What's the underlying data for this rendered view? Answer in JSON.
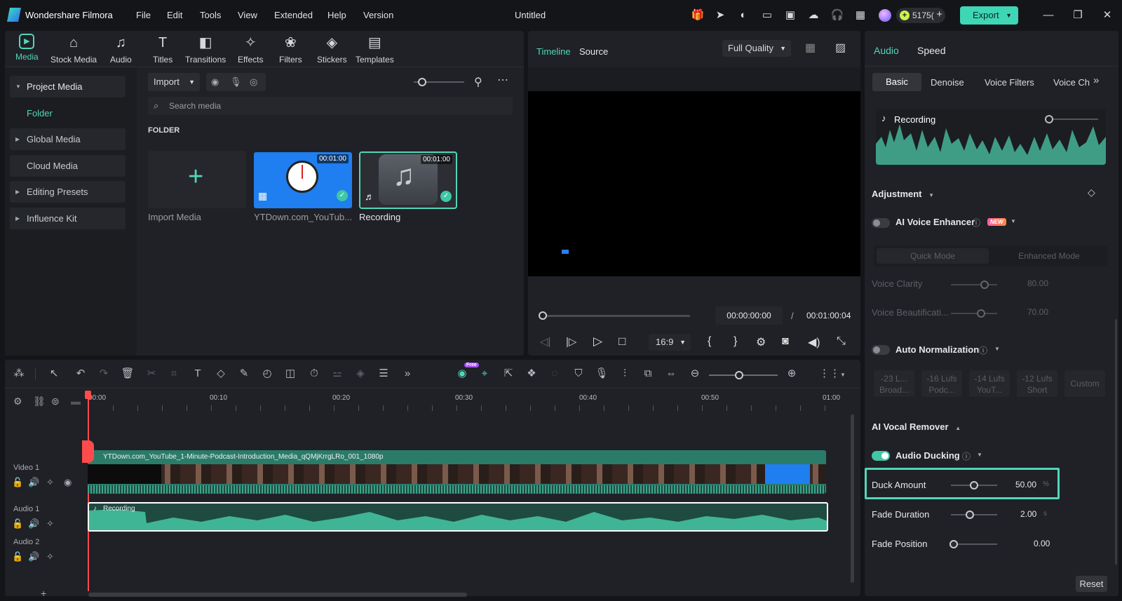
{
  "app": {
    "name": "Wondershare Filmora",
    "doc_title": "Untitled",
    "credits": "5175(",
    "export_label": "Export"
  },
  "menu": [
    "File",
    "Edit",
    "Tools",
    "View",
    "Extended",
    "Help",
    "Version"
  ],
  "media_tabs": [
    "Media",
    "Stock Media",
    "Audio",
    "Titles",
    "Transitions",
    "Effects",
    "Filters",
    "Stickers",
    "Templates"
  ],
  "sidebar": {
    "items": [
      {
        "label": "Project Media",
        "tri": true
      },
      {
        "label": "Folder"
      },
      {
        "label": "Global Media",
        "tri": true
      },
      {
        "label": "Cloud Media"
      },
      {
        "label": "Editing Presets",
        "tri": true
      },
      {
        "label": "Influence Kit",
        "tri": true
      }
    ]
  },
  "media": {
    "import_label": "Import",
    "search_placeholder": "Search media",
    "folder_header": "FOLDER",
    "tiles": [
      {
        "label": "Import Media"
      },
      {
        "label": "YTDown.com_YouTub...",
        "duration": "00:01:00"
      },
      {
        "label": "Recording",
        "duration": "00:01:00"
      }
    ]
  },
  "player": {
    "tabs": [
      "Timeline",
      "Source"
    ],
    "quality": "Full Quality",
    "current_time": "00:00:00:00",
    "separator": "/",
    "total_time": "00:01:00:04",
    "ratio": "16:9"
  },
  "right": {
    "tabs": [
      "Audio",
      "Speed"
    ],
    "subtabs": [
      "Basic",
      "Denoise",
      "Voice Filters",
      "Voice Ch"
    ],
    "clip_name": "Recording",
    "adjustment": "Adjustment",
    "ai_voice_enhancer": "AI Voice Enhancer",
    "new_badge": "NEW",
    "modes": [
      "Quick Mode",
      "Enhanced Mode"
    ],
    "voice_clarity": {
      "label": "Voice Clarity",
      "value": "80.00",
      "level": 0.8
    },
    "voice_beaut": {
      "label": "Voice Beautificati...",
      "value": "70.00",
      "level": 0.7
    },
    "auto_normalization": "Auto Normalization",
    "lufs": [
      [
        "-23 L...",
        "Broad..."
      ],
      [
        "-16 Lufs",
        "Podc..."
      ],
      [
        "-14 Lufs",
        "YouT..."
      ],
      [
        "-12 Lufs",
        "Short"
      ],
      [
        "Custom",
        ""
      ]
    ],
    "ai_vocal_remover": "AI Vocal Remover",
    "audio_ducking": "Audio Ducking",
    "duck_amount": {
      "label": "Duck Amount",
      "value": "50.00",
      "unit": "%",
      "level": 0.5
    },
    "fade_duration": {
      "label": "Fade Duration",
      "value": "2.00",
      "unit": "s",
      "level": 0.4
    },
    "fade_position": {
      "label": "Fade Position",
      "value": "0.00",
      "unit": "",
      "level": 0.0
    },
    "reset_label": "Reset"
  },
  "timeline": {
    "ruler": [
      "00:00",
      "00:10",
      "00:20",
      "00:30",
      "00:40",
      "00:50",
      "01:00"
    ],
    "tracks": [
      "Video 1",
      "Audio 1",
      "Audio 2"
    ],
    "video_clip": "YTDown.com_YouTube_1-Minute-Podcast-Introduction_Media_qQMjKrrgLRo_001_1080p",
    "audio_clip": "Recording",
    "ai_badge": "Free"
  },
  "colors": {
    "accent": "#3fc7a6",
    "bg": "#141519",
    "panel": "#1f2126",
    "highlight": "#52d6b8"
  }
}
